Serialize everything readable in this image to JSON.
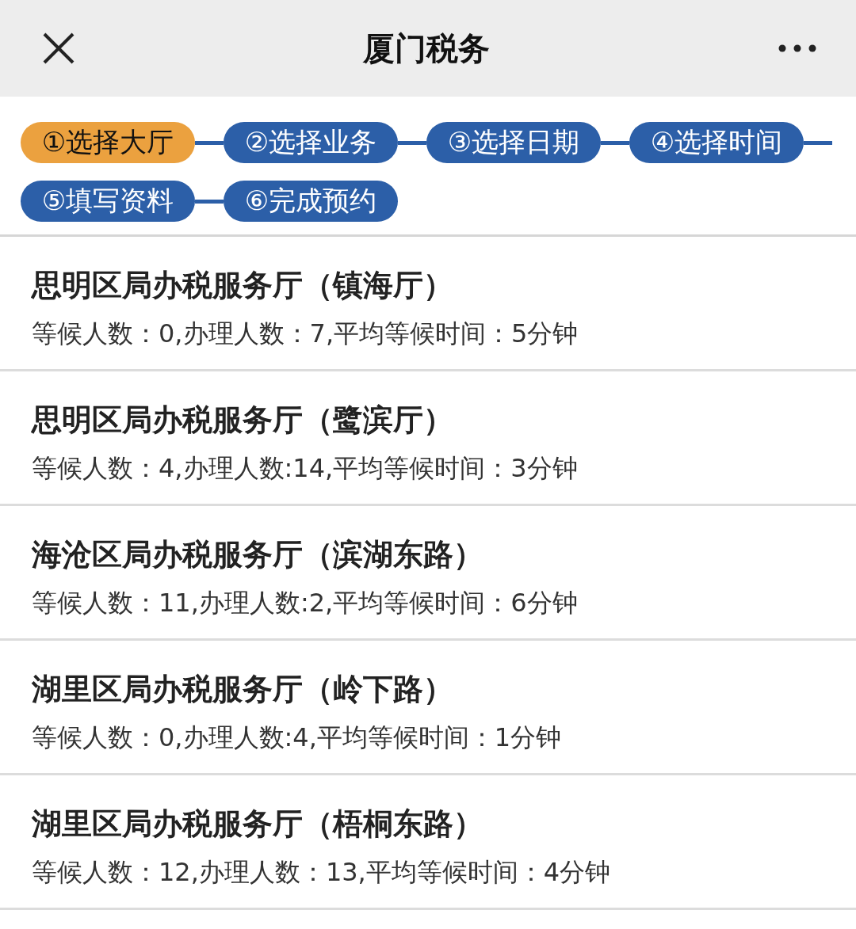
{
  "header": {
    "title": "厦门税务"
  },
  "steps": [
    {
      "label": "①选择大厅",
      "selected": true
    },
    {
      "label": "②选择业务",
      "selected": false
    },
    {
      "label": "③选择日期",
      "selected": false
    },
    {
      "label": "④选择时间",
      "selected": false
    },
    {
      "label": "⑤填写资料",
      "selected": false
    },
    {
      "label": "⑥完成预约",
      "selected": false
    }
  ],
  "halls": [
    {
      "name": "思明区局办税服务厅（镇海厅）",
      "info": "等候人数：0,办理人数：7,平均等候时间：5分钟"
    },
    {
      "name": "思明区局办税服务厅（鹭滨厅）",
      "info": "等候人数：4,办理人数:14,平均等候时间：3分钟"
    },
    {
      "name": "海沧区局办税服务厅（滨湖东路）",
      "info": "等候人数：11,办理人数:2,平均等候时间：6分钟"
    },
    {
      "name": "湖里区局办税服务厅（岭下路）",
      "info": "等候人数：0,办理人数:4,平均等候时间：1分钟"
    },
    {
      "name": "湖里区局办税服务厅（梧桐东路）",
      "info": "等候人数：12,办理人数：13,平均等候时间：4分钟"
    }
  ]
}
